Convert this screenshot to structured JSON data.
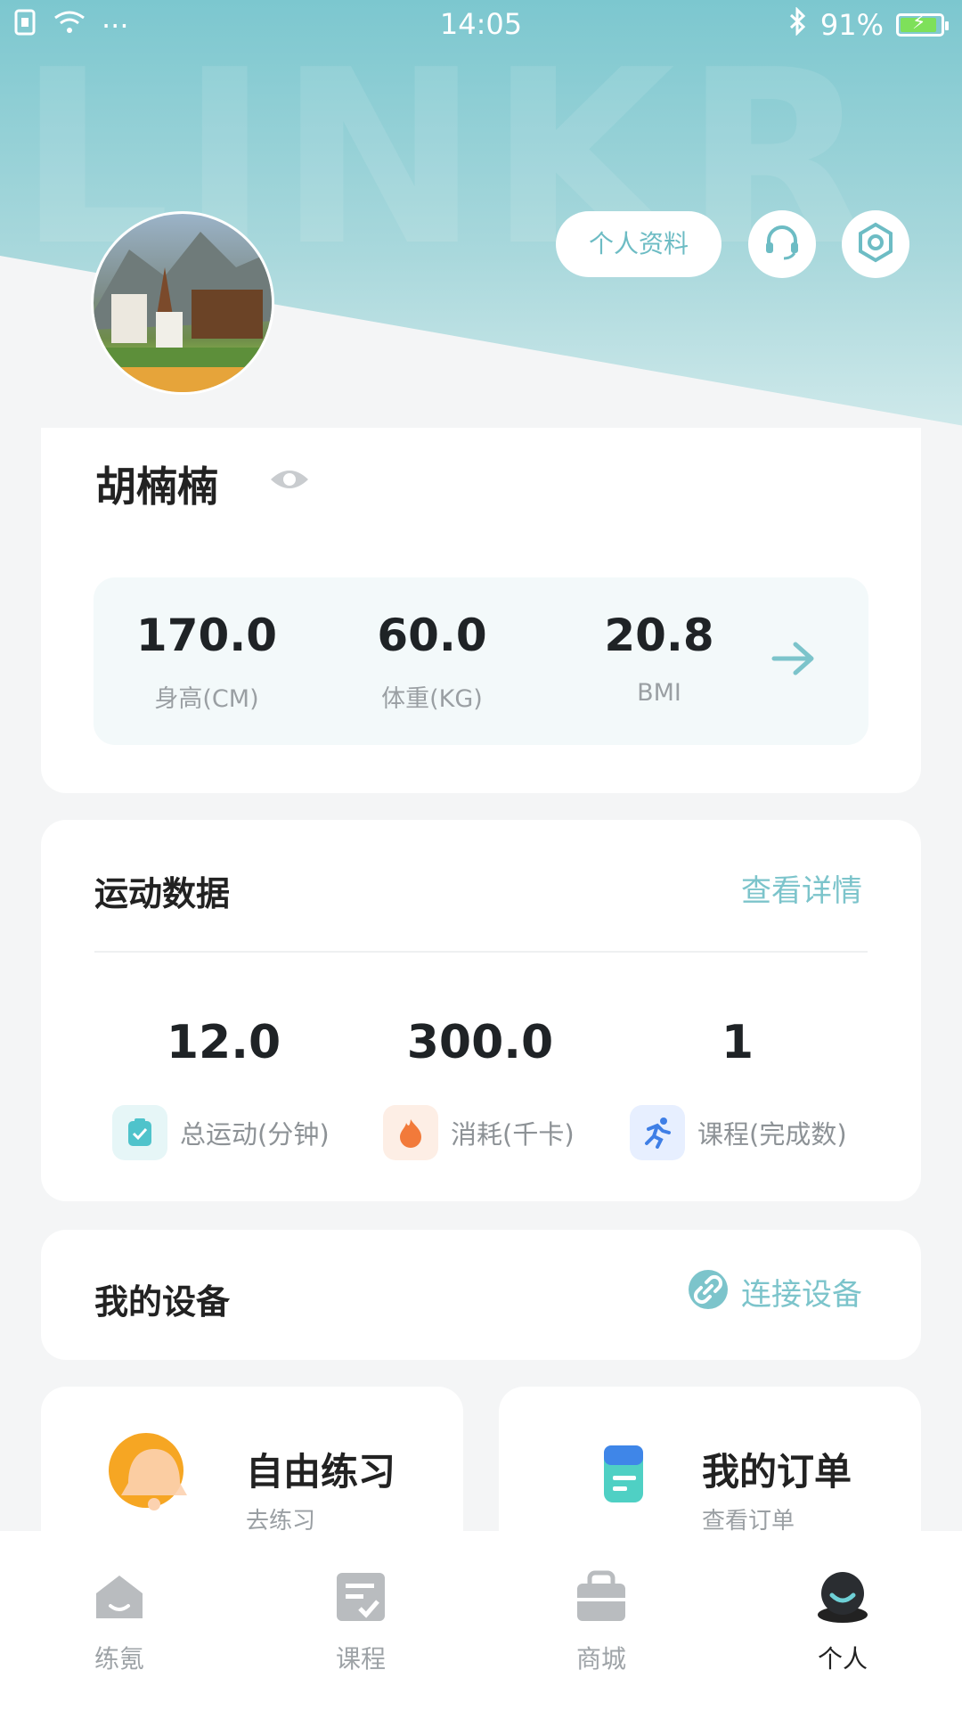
{
  "status_bar": {
    "time": "14:05",
    "battery_text": "91%",
    "dots": "···"
  },
  "hero": {
    "watermark": "LINKR"
  },
  "header_actions": {
    "profile_label": "个人资料",
    "support_icon": "headset-icon",
    "settings_icon": "hexagon-settings-icon"
  },
  "profile": {
    "name": "胡楠楠",
    "visibility_icon": "eye-icon",
    "stats": [
      {
        "value": "170.0",
        "label": "身高(CM)"
      },
      {
        "value": "60.0",
        "label": "体重(KG)"
      },
      {
        "value": "20.8",
        "label": "BMI"
      }
    ],
    "arrow_icon": "arrow-right-icon"
  },
  "sport_data": {
    "title": "运动数据",
    "link": "查看详情",
    "items": [
      {
        "value": "12.0",
        "label": "总运动(分钟)",
        "icon": "clipboard-check-icon",
        "color": "#4fc3cb"
      },
      {
        "value": "300.0",
        "label": "消耗(千卡)",
        "icon": "flame-icon",
        "color": "#f27a3a"
      },
      {
        "value": "1",
        "label": "课程(完成数)",
        "icon": "runner-icon",
        "color": "#3f7fe6"
      }
    ]
  },
  "devices": {
    "title": "我的设备",
    "link": "连接设备",
    "link_icon": "link-icon"
  },
  "tiles": [
    {
      "title": "自由练习",
      "subtitle": "去练习",
      "icon": "bell-icon"
    },
    {
      "title": "我的订单",
      "subtitle": "查看订单",
      "icon": "order-doc-icon"
    }
  ],
  "tabbar": {
    "items": [
      {
        "label": "练氪",
        "icon": "home-icon"
      },
      {
        "label": "课程",
        "icon": "course-icon"
      },
      {
        "label": "商城",
        "icon": "shop-bag-icon"
      },
      {
        "label": "个人",
        "icon": "profile-icon"
      }
    ]
  },
  "colors": {
    "accent": "#7cc4cb",
    "header": "#7cc7cf"
  }
}
